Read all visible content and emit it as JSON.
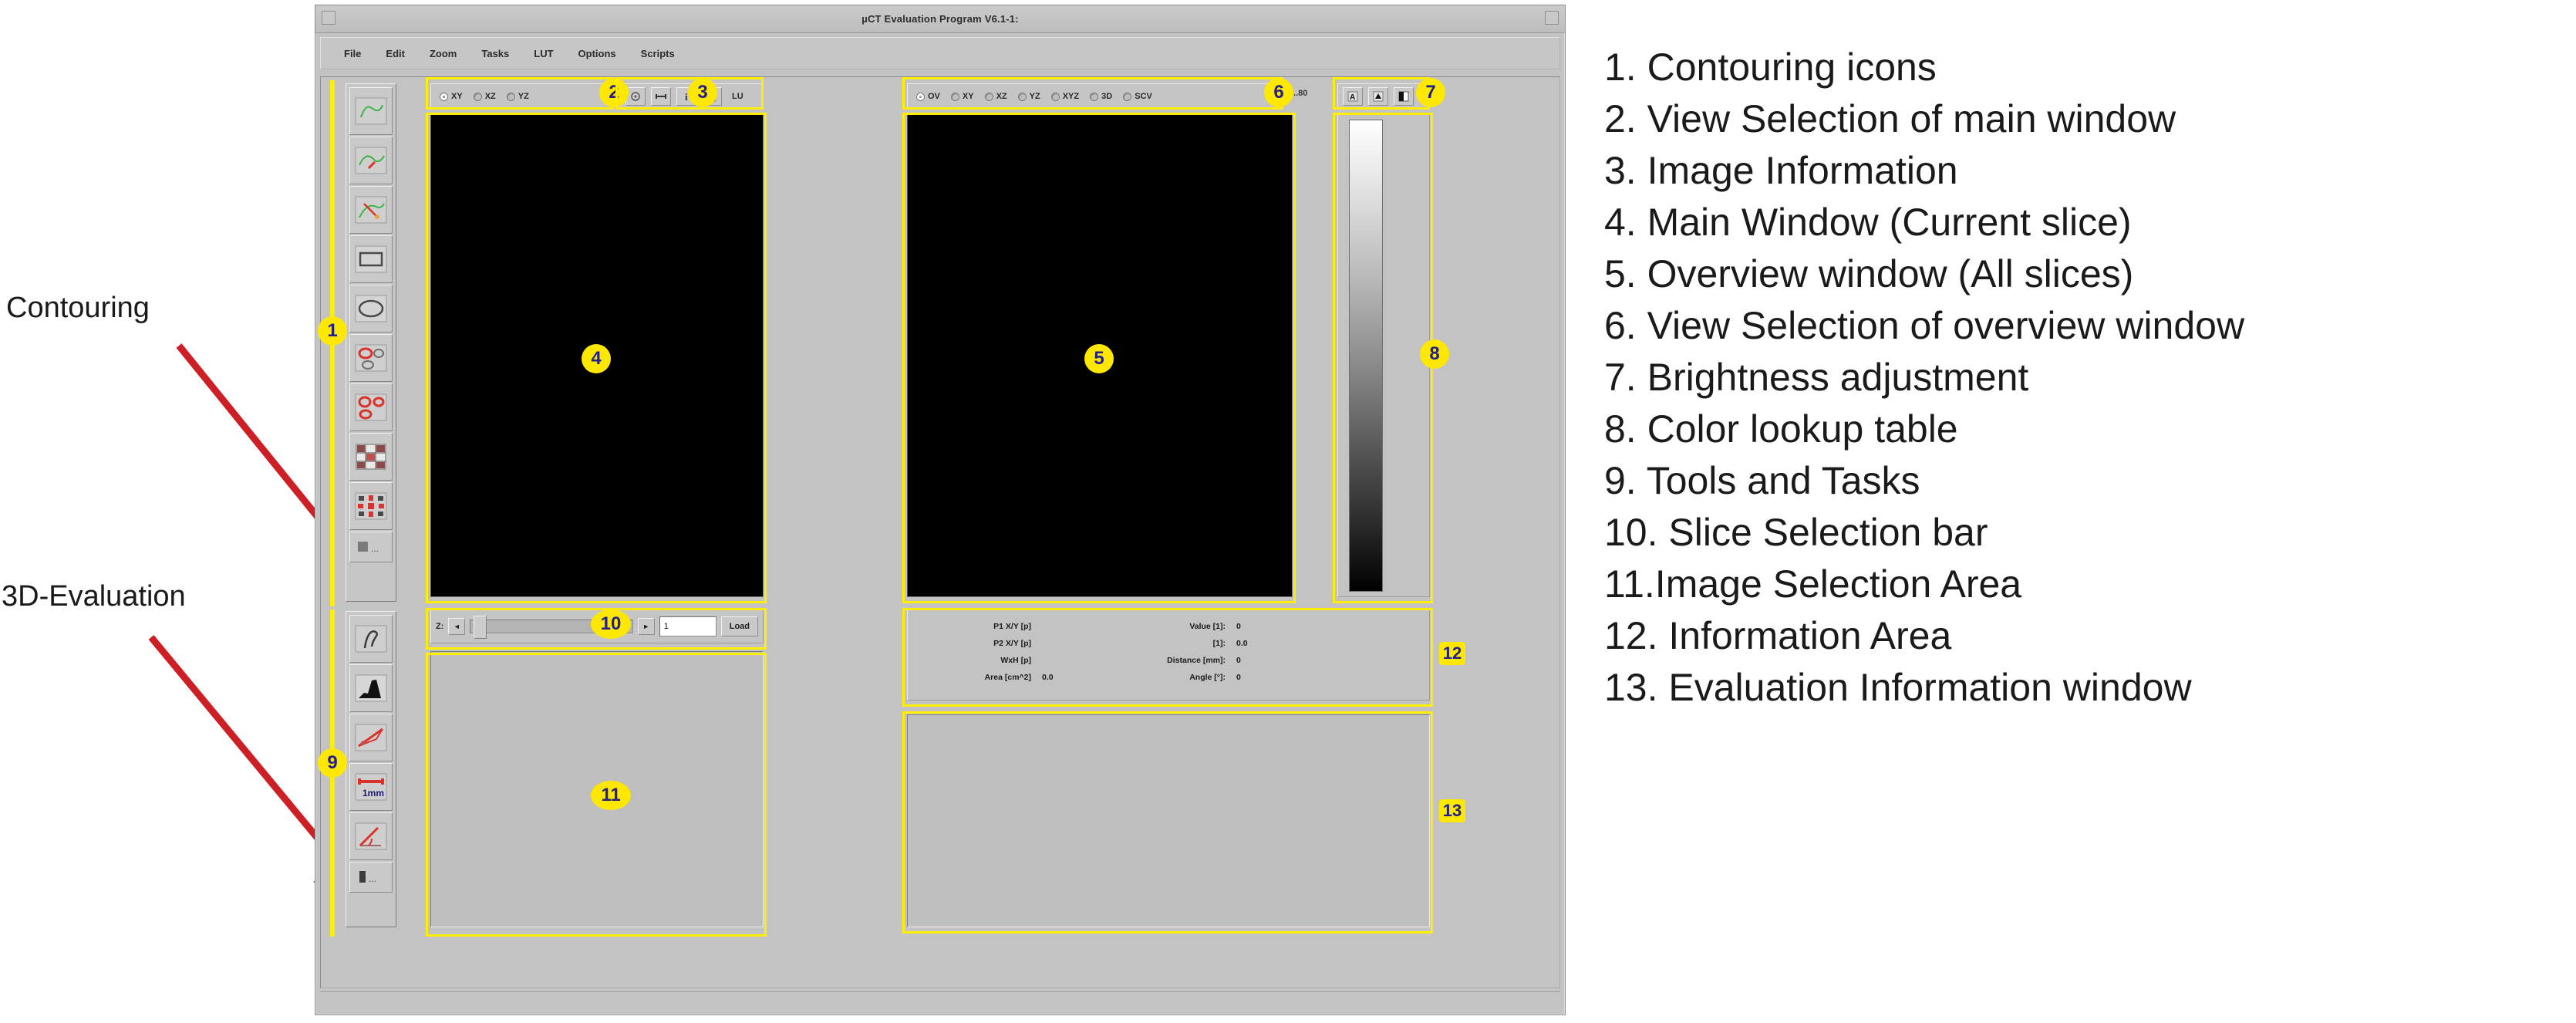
{
  "side_labels": {
    "contouring": "Contouring",
    "evaluation": "3D-Evaluation"
  },
  "window": {
    "title": "µCT Evaluation Program V6.1-1:",
    "menu": [
      "File",
      "Edit",
      "Zoom",
      "Tasks",
      "LUT",
      "Options",
      "Scripts"
    ]
  },
  "main_view_selection": {
    "options": [
      "XY",
      "XZ",
      "YZ"
    ],
    "selected": "XY"
  },
  "image_info_toolbar": {
    "icons": [
      "target-icon",
      "ruler-icon",
      "info-i-icon",
      "lock-icon"
    ],
    "flat_label": "LU"
  },
  "overview_view_selection": {
    "options": [
      "OV",
      "XY",
      "XZ",
      "YZ",
      "XYZ",
      "3D",
      "SCV"
    ],
    "selected": "OV"
  },
  "brightness": {
    "value_label": "...80",
    "buttons": [
      "brightness-auto-icon",
      "brightness-up-icon",
      "brightness-contrast-icon"
    ]
  },
  "contouring_tools": {
    "title": "Contouring icons",
    "items": [
      "contour-area-icon",
      "contour-draw-icon",
      "contour-line-icon",
      "contour-rect-icon",
      "contour-ellipse-icon",
      "contour-copy-icon",
      "contour-multi-icon",
      "contour-grid-icon",
      "contour-morph-icon",
      "contour-more-icon"
    ]
  },
  "evaluation_tools": {
    "title": "3D-Evaluation",
    "items": [
      "eval-curve-icon",
      "eval-histogram-icon",
      "eval-profile-icon",
      "eval-distance-icon",
      "eval-angle-icon",
      "eval-more-icon"
    ]
  },
  "slice_bar": {
    "axis_label": "Z:",
    "prev_label": "◄",
    "next_label": "►",
    "value": "1",
    "load_label": "Load"
  },
  "information_area": {
    "left": [
      {
        "key": "P1 X/Y [p]",
        "value": ""
      },
      {
        "key": "P2 X/Y [p]",
        "value": ""
      },
      {
        "key": "WxH [p]",
        "value": ""
      },
      {
        "key": "Area [cm^2]",
        "value": "0.0"
      }
    ],
    "right": [
      {
        "key": "Value [1]:",
        "value": "0"
      },
      {
        "key": "[1]:",
        "value": "0.0"
      },
      {
        "key": "Distance [mm]:",
        "value": "0"
      },
      {
        "key": "Angle [°]:",
        "value": "0"
      }
    ]
  },
  "markers": {
    "m1": "1",
    "m2": "2",
    "m3": "3",
    "m4": "4",
    "m5": "5",
    "m6": "6",
    "m7": "7",
    "m8": "8",
    "m9": "9",
    "m10": "10",
    "m11": "11",
    "m12": "12",
    "m13": "13"
  },
  "legend": [
    "1. Contouring icons",
    "2. View Selection of main window",
    "3. Image Information",
    "4. Main Window (Current slice)",
    "5. Overview window (All slices)",
    "6. View Selection of overview window",
    "7. Brightness adjustment",
    "8. Color lookup table",
    "9. Tools and Tasks",
    "10. Slice Selection bar",
    "11.Image Selection Area",
    "12. Information Area",
    "13. Evaluation Information window"
  ],
  "colors": {
    "callout": "#ffee00",
    "marker_text": "#23208c",
    "arrow": "#cc2026",
    "window_bg": "#c3c3c3",
    "viewport_bg": "#000000"
  }
}
